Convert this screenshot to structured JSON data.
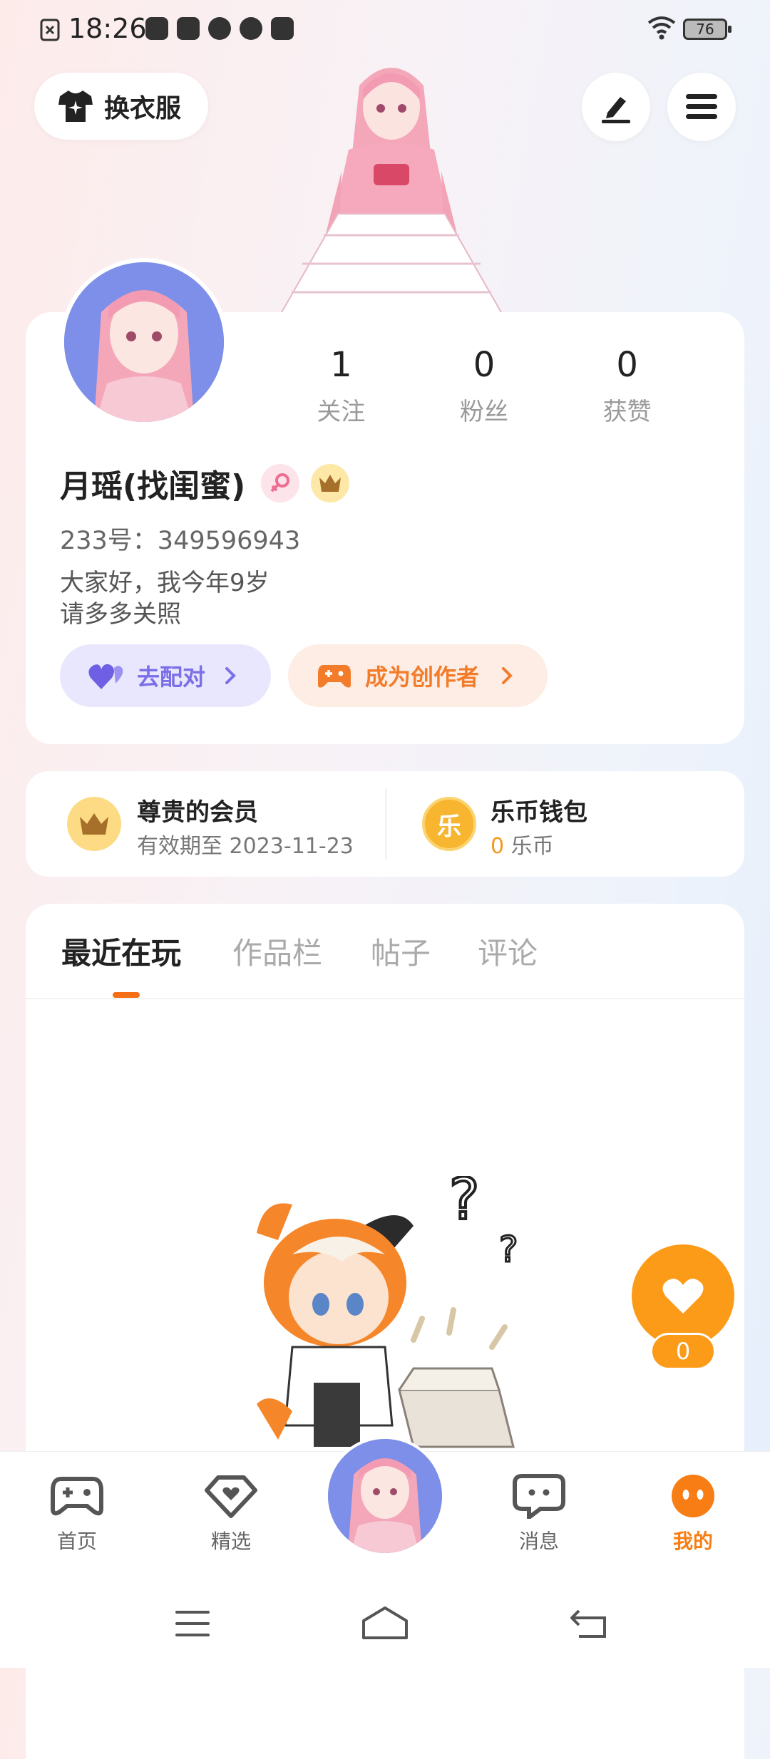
{
  "status_bar": {
    "time": "18:26",
    "battery": "76"
  },
  "header": {
    "outfit_label": "换衣服"
  },
  "profile": {
    "name": "月瑶(找闺蜜)",
    "uid": "233号：349596943",
    "bio_line1": "大家好，我今年9岁",
    "bio_line2": "请多多关照",
    "stats": [
      {
        "num": "1",
        "label": "关注"
      },
      {
        "num": "0",
        "label": "粉丝"
      },
      {
        "num": "0",
        "label": "获赞"
      }
    ],
    "pair_label": "去配对",
    "creator_label": "成为创作者"
  },
  "membership": {
    "title": "尊贵的会员",
    "expiry": "有效期至 2023-11-23"
  },
  "wallet": {
    "title": "乐币钱包",
    "coin_char": "乐",
    "amount": "0",
    "unit": "乐币"
  },
  "tabs": [
    {
      "label": "最近在玩"
    },
    {
      "label": "作品栏"
    },
    {
      "label": "帖子"
    },
    {
      "label": "评论"
    }
  ],
  "like_count": "0",
  "bottom_nav": [
    {
      "label": "首页"
    },
    {
      "label": "精选"
    },
    {
      "label": "消息"
    },
    {
      "label": "我的"
    }
  ],
  "colors": {
    "accent": "#f77d14",
    "pair": "#7a6fe6",
    "creator": "#f27c2a",
    "like": "#fb9b18"
  }
}
